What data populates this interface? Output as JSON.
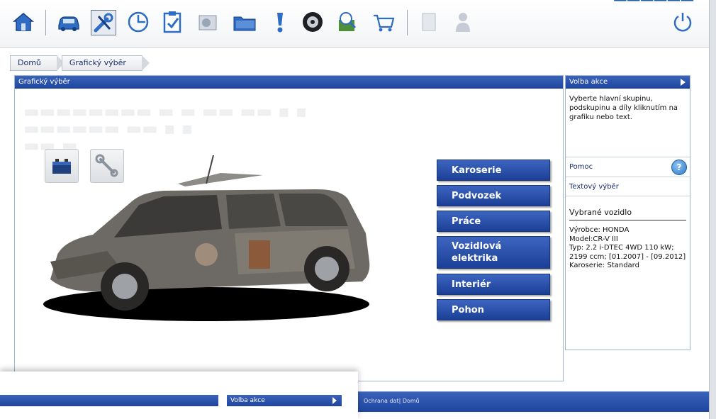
{
  "breadcrumb": [
    "Domů",
    "Grafický výběr"
  ],
  "main_panel": {
    "title": "Grafický výběr"
  },
  "groups": [
    "Karoserie",
    "Podvozek",
    "Práce",
    "Vozidlová elektrika",
    "Interiér",
    "Pohon"
  ],
  "side_panel": {
    "title": "Volba akce",
    "instruction": "Vyberte hlavní skupinu, podskupinu a díly kliknutím na grafiku nebo text.",
    "help_label": "Pomoc",
    "text_select_label": "Textový výběr",
    "vehicle_title": "Vybrané vozidlo",
    "vehicle_maker": "Výrobce: HONDA",
    "vehicle_model": "Model:CR-V III",
    "vehicle_type": "Typ: 2.2 i-DTEC 4WD 110 kW; 2199 ccm; [01.2007] - [09.2012]",
    "vehicle_body": "Karoserie: Standard"
  },
  "footer": {
    "text": "Ochrana dat| Domů"
  },
  "overlay": {
    "side_title": "Volba akce"
  },
  "colors": {
    "accent": "#1e46a0",
    "button": "#2a4fb0"
  },
  "toolbar_icons": [
    "home-icon",
    "car-icon",
    "tools-icon",
    "clock-icon",
    "checklist-icon",
    "parts-icon",
    "folder-icon",
    "warning-icon",
    "wheel-icon",
    "search-icon",
    "cart-icon",
    "document-icon",
    "user-icon",
    "power-icon"
  ]
}
